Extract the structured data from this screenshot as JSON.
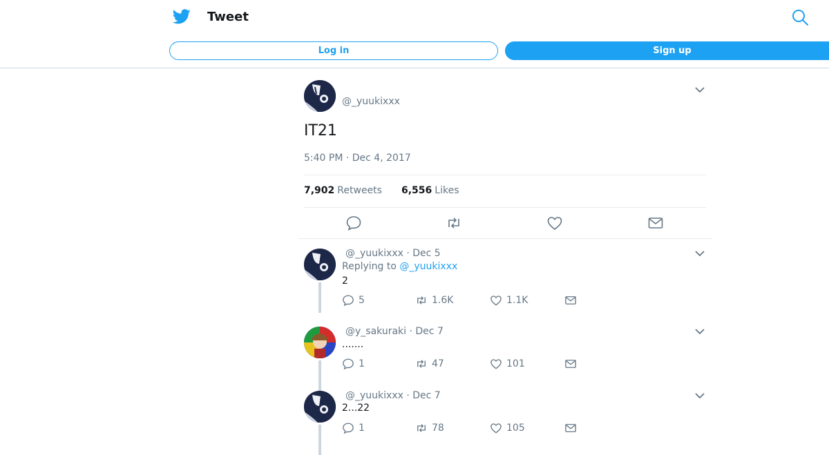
{
  "header": {
    "title": "Tweet",
    "login_label": "Log in",
    "signup_label": "Sign up",
    "icons": [
      "twitter-bird-icon",
      "search-icon"
    ]
  },
  "tweet": {
    "handle": "@_yuukixxx",
    "text": "IT21",
    "timestamp": "5:40 PM · Dec 4, 2017",
    "retweets_count": "7,902",
    "retweets_label": "Retweets",
    "likes_count": "6,556",
    "likes_label": "Likes"
  },
  "replies": [
    {
      "handle": "@_yuukixxx",
      "date": "Dec 5",
      "replying_prefix": "Replying to",
      "replying_to": "@_yuukixxx",
      "text": "2",
      "replies": "5",
      "retweets": "1.6K",
      "likes": "1.1K"
    },
    {
      "handle": "@y_sakuraki",
      "date": "Dec 7",
      "text": ".......",
      "replies": "1",
      "retweets": "47",
      "likes": "101"
    },
    {
      "handle": "@_yuukixxx",
      "date": "Dec 7",
      "text": "2...22",
      "replies": "1",
      "retweets": "78",
      "likes": "105"
    }
  ],
  "colors": {
    "accent": "#1da1f2",
    "secondary_text": "#657786",
    "divider": "#e6ecf0"
  }
}
